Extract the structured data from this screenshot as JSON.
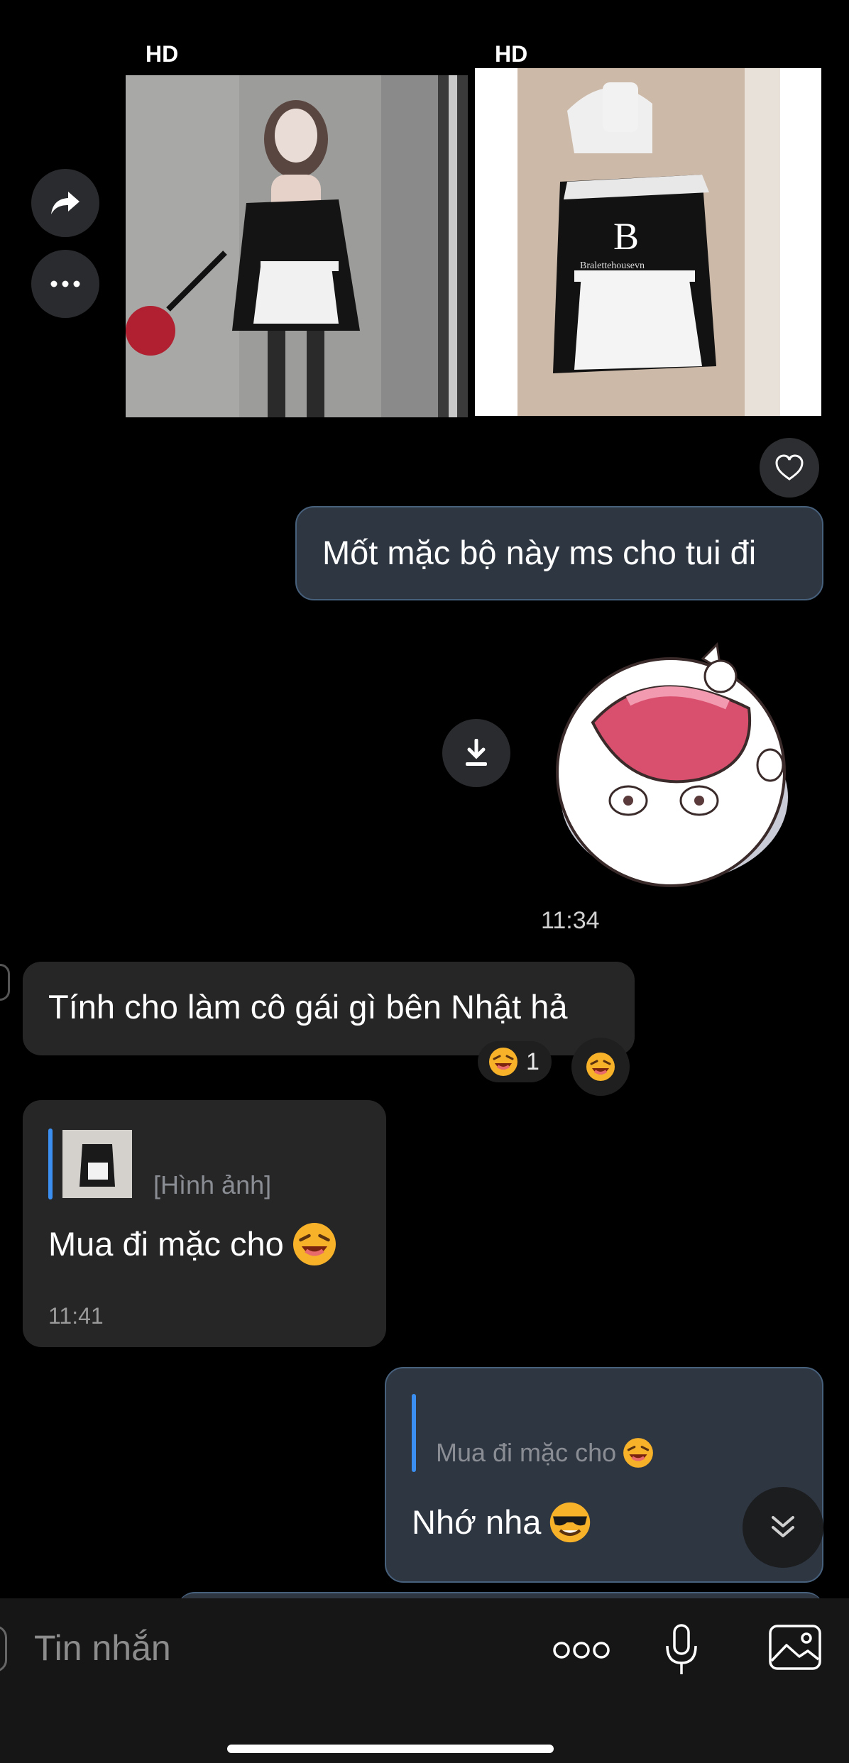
{
  "media": {
    "badge_left": "HD",
    "badge_right": "HD",
    "watermark_text": "Bralettehousevn"
  },
  "messages": {
    "outgoing_1": "Mốt mặc bộ này ms cho tui đi",
    "sticker_time": "11:34",
    "incoming_1": "Tính cho làm cô gái gì bên Nhật hả",
    "reaction_count": "1",
    "incoming_2": {
      "quote_label": "[Hình ảnh]",
      "text": "Mua đi mặc cho",
      "time": "11:41"
    },
    "outgoing_2": {
      "quote_text": "Mua đi mặc cho",
      "text": "Nhớ nha"
    }
  },
  "composer": {
    "placeholder": "Tin nhắn"
  },
  "icons": {
    "forward": "forward-icon",
    "more": "more-horizontal-icon",
    "heart": "heart-icon",
    "download": "download-icon",
    "scroll_down": "chevron-double-down-icon",
    "more_options": "ooo-icon",
    "mic": "microphone-icon",
    "gallery": "image-icon",
    "laugh_emoji": "laughing-emoji-icon",
    "cool_emoji": "sunglasses-emoji-icon"
  },
  "colors": {
    "outgoing_bubble": "#2e3642",
    "outgoing_border": "#47607c",
    "incoming_bubble": "#262626",
    "quote_accent": "#3b8ff0"
  }
}
